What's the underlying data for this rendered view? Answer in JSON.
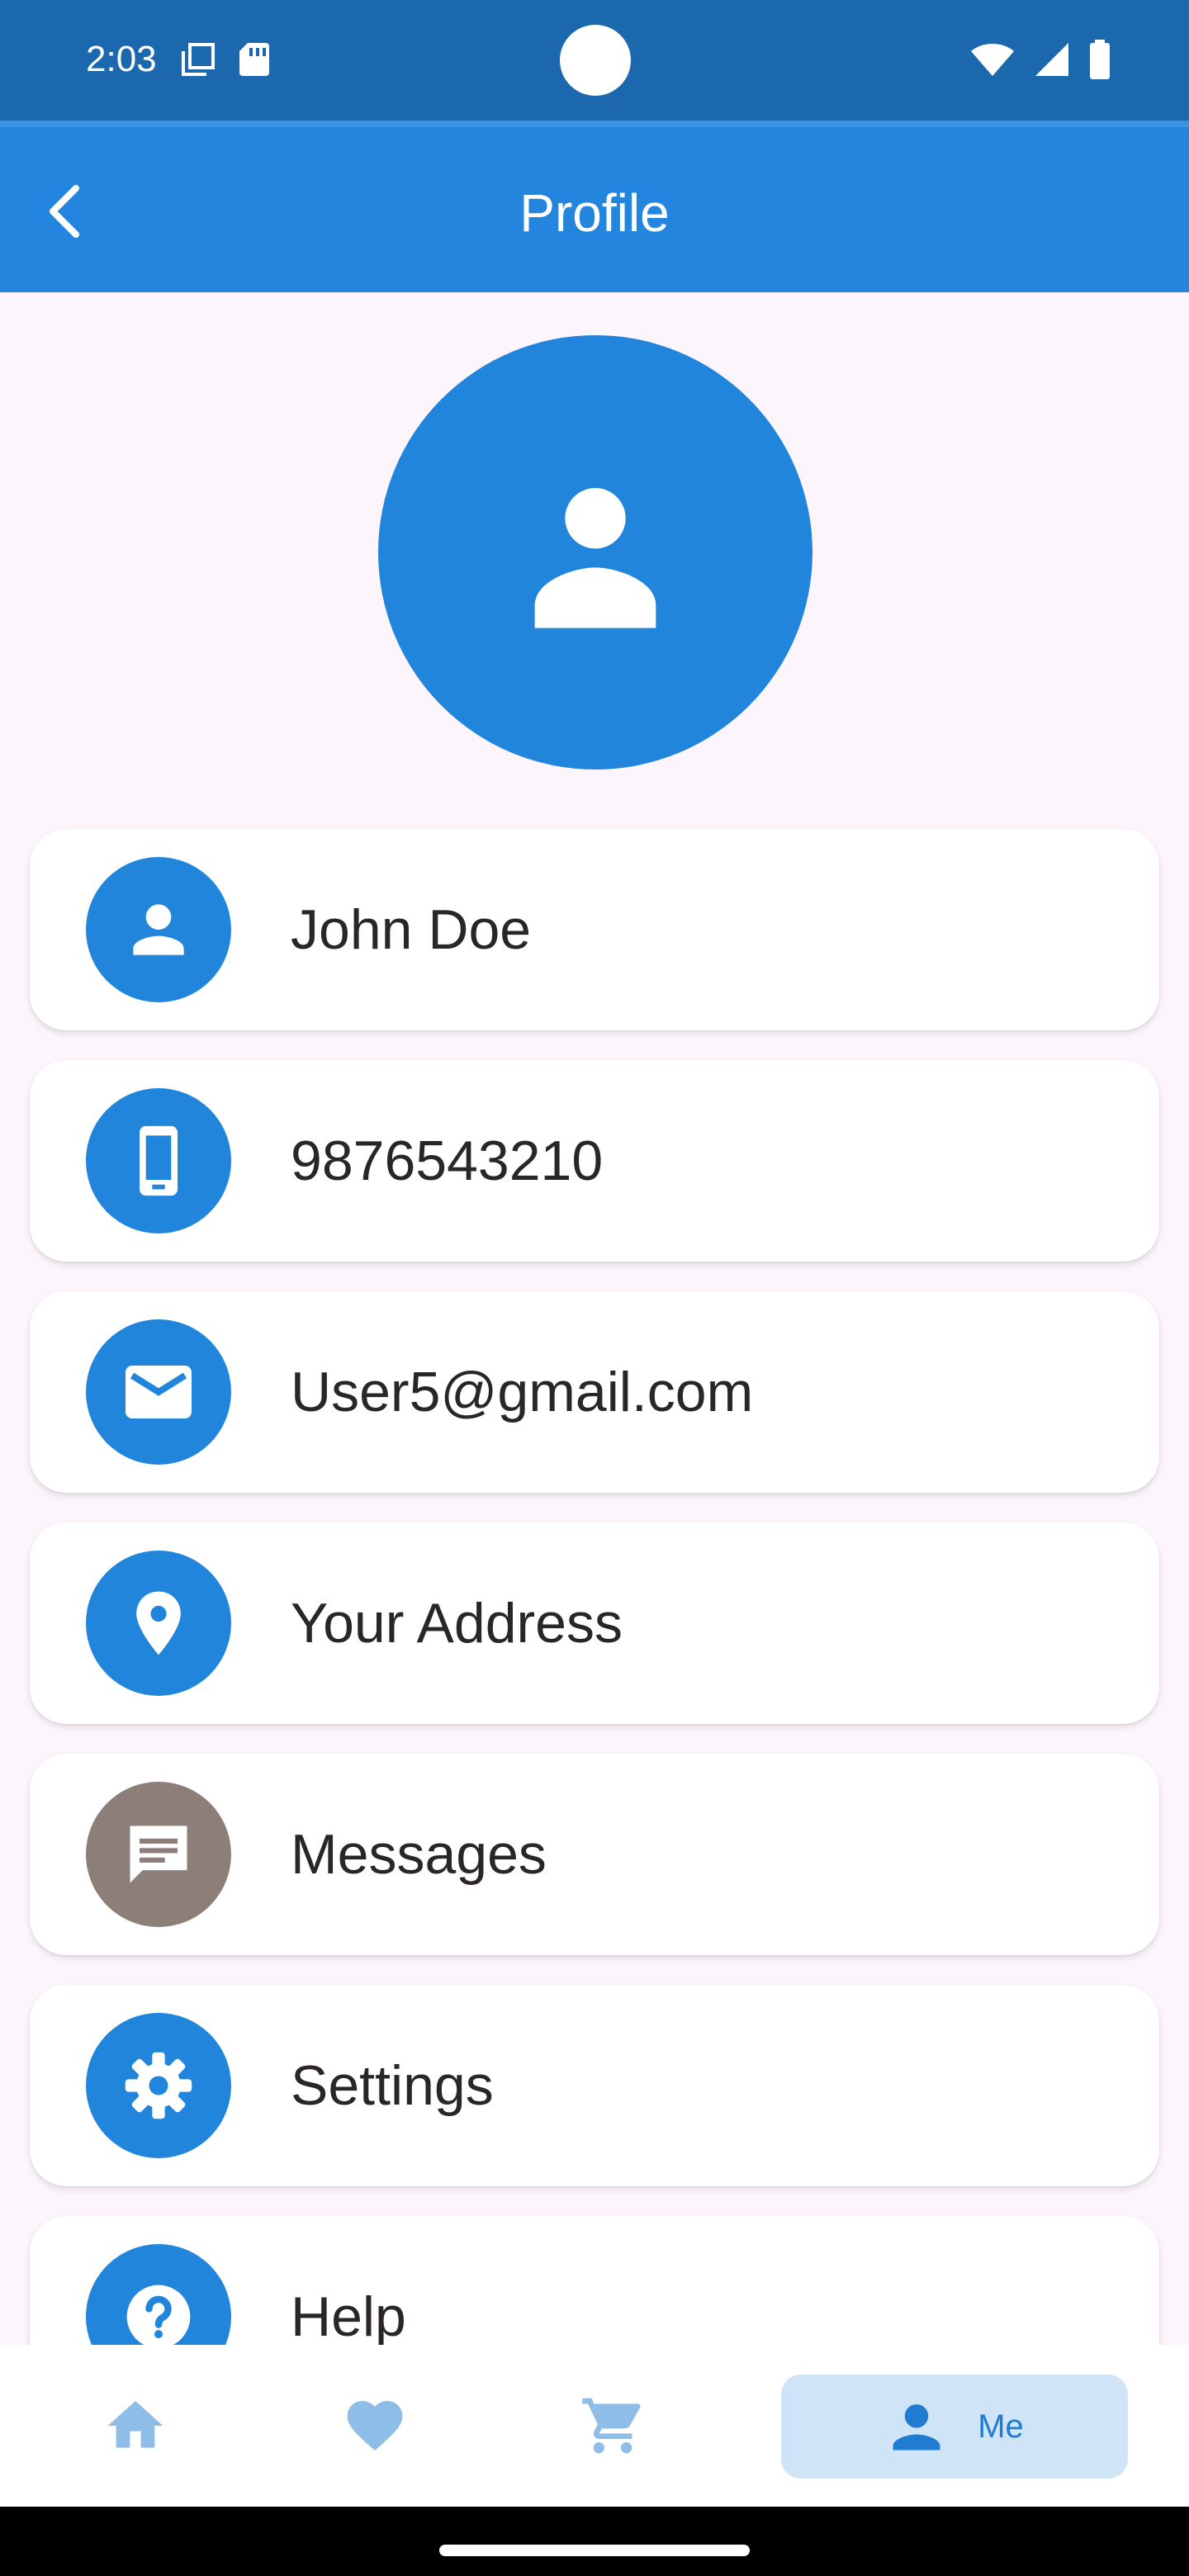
{
  "status_bar": {
    "time": "2:03",
    "icons_left": [
      "screen-icon",
      "sd-card-icon"
    ],
    "icons_right": [
      "wifi-icon",
      "signal-icon",
      "battery-icon"
    ]
  },
  "app_bar": {
    "title": "Profile",
    "back_icon": "chevron-left-icon"
  },
  "profile": {
    "avatar_icon": "person-icon"
  },
  "items": [
    {
      "label": "John Doe",
      "icon": "person-icon"
    },
    {
      "label": "9876543210",
      "icon": "smartphone-icon"
    },
    {
      "label": "User5@gmail.com",
      "icon": "mail-icon"
    },
    {
      "label": "Your Address",
      "icon": "location-pin-icon"
    },
    {
      "label": "Messages",
      "icon": "chat-icon"
    },
    {
      "label": "Settings",
      "icon": "gear-icon"
    },
    {
      "label": "Help",
      "icon": "help-icon"
    }
  ],
  "bottom_nav": {
    "items": [
      {
        "icon": "home-icon",
        "active": false
      },
      {
        "icon": "heart-icon",
        "active": false
      },
      {
        "icon": "cart-icon",
        "active": false
      },
      {
        "icon": "person-icon",
        "label": "Me",
        "active": true
      }
    ]
  },
  "colors": {
    "primary": "#2185DB",
    "status_bar": "#1B68AE",
    "app_bar": "#2385DD",
    "background": "#FCF5FC",
    "messages_icon_bg": "#8C7E78",
    "nav_active_bg": "#CFE4F6",
    "nav_inactive": "#8EBEE8"
  }
}
